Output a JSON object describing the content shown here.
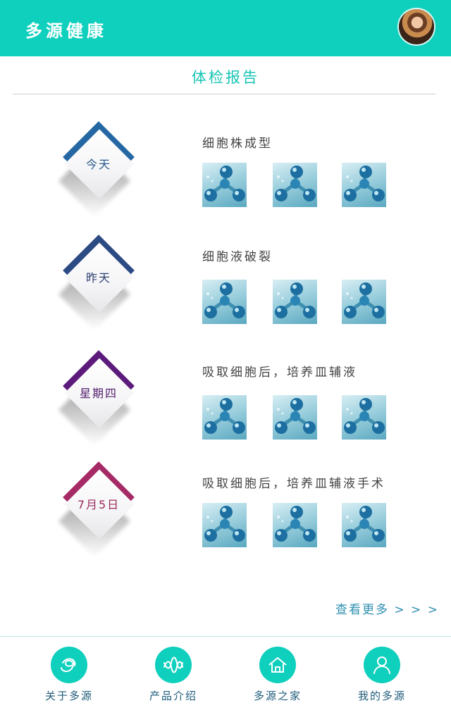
{
  "header": {
    "title": "多源健康"
  },
  "report": {
    "title": "体检报告"
  },
  "entries": [
    {
      "date": "今天",
      "title": "细胞株成型",
      "color": "#2467a3",
      "dateColor": "#25588c"
    },
    {
      "date": "昨天",
      "title": "细胞液破裂",
      "color": "#2c4a84",
      "dateColor": "#2a3f70"
    },
    {
      "date": "星期四",
      "title": "吸取细胞后，培养皿辅液",
      "color": "#5c1a7c",
      "dateColor": "#55206f"
    },
    {
      "date": "7月5日",
      "title": "吸取细胞后，培养皿辅液手术",
      "color": "#a52a66",
      "dateColor": "#9a2a5c"
    }
  ],
  "more": {
    "label": "查看更多 > > >"
  },
  "nav": [
    {
      "label": "关于多源",
      "icon": "about-icon"
    },
    {
      "label": "产品介绍",
      "icon": "dna-icon"
    },
    {
      "label": "多源之家",
      "icon": "home-icon"
    },
    {
      "label": "我的多源",
      "icon": "user-icon"
    }
  ],
  "colors": {
    "accent": "#0fcfbd",
    "link": "#2f8fb0"
  }
}
